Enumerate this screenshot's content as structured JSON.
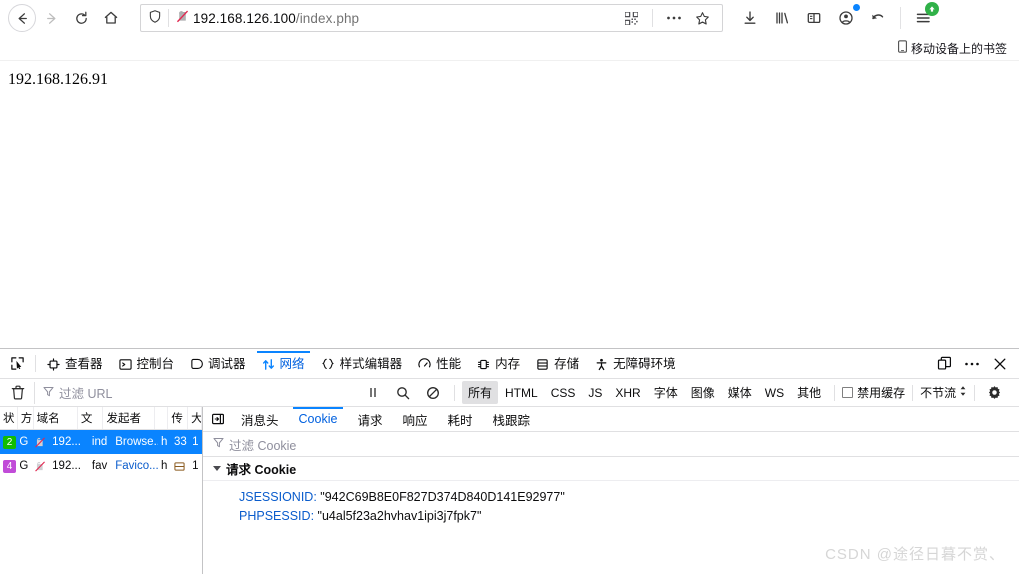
{
  "browser": {
    "nav": {
      "back_label": "后退",
      "forward_label": "前进",
      "reload_label": "重新载入",
      "home_label": "主页"
    },
    "urlbar": {
      "host": "192.168.126.100",
      "path": "/index.php",
      "shield_label": "跟踪保护",
      "insecure_label": "不安全连接",
      "qr_label": "二维码",
      "more_label": "页面操作",
      "bookmark_label": "收藏此页"
    },
    "toolbar_right": {
      "downloads_label": "下载",
      "library_label": "书签库",
      "sidebar_label": "侧边栏",
      "account_label": "账户",
      "sync_label": "同步",
      "menu_label": "打开应用程序菜单"
    },
    "bookmarks_bar": {
      "mobile_bookmarks": "移动设备上的书签"
    }
  },
  "page": {
    "body_text": "192.168.126.91"
  },
  "devtools": {
    "picker_label": "选取页面中的元素",
    "tabs": [
      {
        "label": "查看器",
        "icon": "inspector-icon",
        "active": false
      },
      {
        "label": "控制台",
        "icon": "console-icon",
        "active": false
      },
      {
        "label": "调试器",
        "icon": "debugger-icon",
        "active": false
      },
      {
        "label": "网络",
        "icon": "network-icon",
        "active": true
      },
      {
        "label": "样式编辑器",
        "icon": "style-editor-icon",
        "active": false
      },
      {
        "label": "性能",
        "icon": "performance-icon",
        "active": false
      },
      {
        "label": "内存",
        "icon": "memory-icon",
        "active": false
      },
      {
        "label": "存储",
        "icon": "storage-icon",
        "active": false
      },
      {
        "label": "无障碍环境",
        "icon": "accessibility-icon",
        "active": false
      }
    ],
    "right_buttons": [
      {
        "name": "dock-toggle-button",
        "label": "停靠位置"
      },
      {
        "name": "devtools-more-button",
        "label": "更多"
      },
      {
        "name": "devtools-close-button",
        "label": "关闭"
      }
    ],
    "filterbar": {
      "trash_label": "清空",
      "filter_placeholder": "过滤 URL",
      "pause_label": "暂停",
      "search_label": "搜索",
      "block_label": "屏蔽",
      "types": [
        "所有",
        "HTML",
        "CSS",
        "JS",
        "XHR",
        "字体",
        "图像",
        "媒体",
        "WS",
        "其他"
      ],
      "active_type": "所有",
      "disable_cache": "禁用缓存",
      "throttle": "不节流",
      "settings_label": "网络设置"
    },
    "network_table": {
      "columns": [
        "状",
        "方",
        "域名",
        "文",
        "发起者",
        "",
        "传",
        "大"
      ],
      "rows": [
        {
          "status": "2",
          "status_color": "green",
          "method": "G",
          "domain": "192...",
          "file": "ind",
          "initiator": "Browse...",
          "type": "h",
          "transfer": "33",
          "size": "1",
          "selected": true
        },
        {
          "status": "4",
          "status_color": "purple",
          "method": "G",
          "domain": "192...",
          "file": "fav",
          "initiator": "Favico...",
          "type": "h",
          "transfer": "缓存",
          "size": "1",
          "selected": false
        }
      ]
    },
    "detail": {
      "back_label": "返回",
      "tabs": [
        {
          "label": "消息头",
          "active": false
        },
        {
          "label": "Cookie",
          "active": true
        },
        {
          "label": "请求",
          "active": false
        },
        {
          "label": "响应",
          "active": false
        },
        {
          "label": "耗时",
          "active": false
        },
        {
          "label": "栈跟踪",
          "active": false
        }
      ],
      "filter_placeholder": "过滤 Cookie",
      "section_title": "请求 Cookie",
      "cookies": [
        {
          "name": "JSESSIONID",
          "value": "\"942C69B8E0F827D374D840D141E92977\""
        },
        {
          "name": "PHPSESSID",
          "value": "\"u4al5f23a2hvhav1ipi3j7fpk7\""
        }
      ]
    }
  },
  "watermark": {
    "text": "CSDN @途径日暮不赏、"
  },
  "colors": {
    "accent_blue": "#0a84ff",
    "link_blue": "#0a5ccc",
    "status_200": "#12bc00",
    "status_404": "#c14cd8",
    "update_green": "#30b148"
  }
}
